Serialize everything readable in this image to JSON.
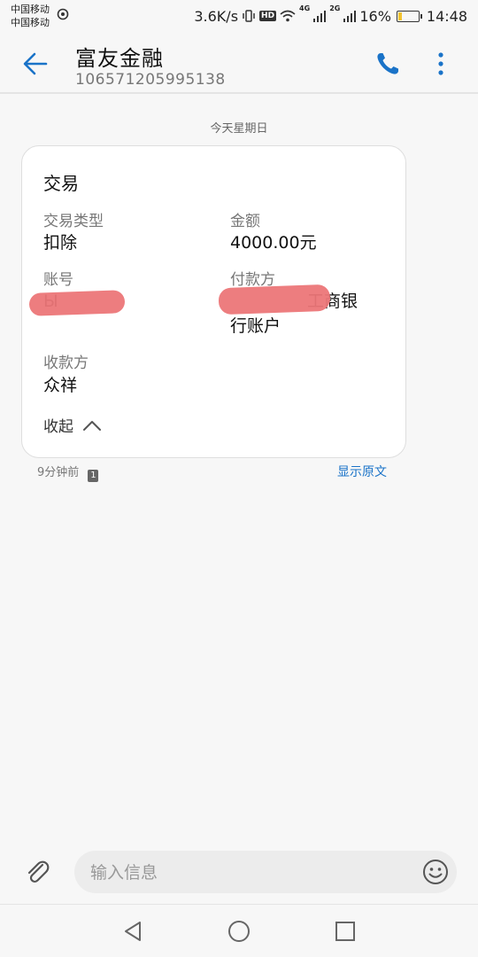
{
  "status_bar": {
    "carrier1": "中国移动",
    "carrier2": "中国移动",
    "speed": "3.6K/s",
    "hd": "HD",
    "net1": "4G",
    "net2": "2G",
    "battery": "16%",
    "battery_level": 0.16,
    "time": "14:48"
  },
  "header": {
    "title": "富友金融",
    "number": "106571205995138"
  },
  "conversation": {
    "date_label": "今天星期日"
  },
  "card": {
    "title": "交易",
    "fields": [
      {
        "label": "交易类型",
        "value": "扣除"
      },
      {
        "label": "金额",
        "value": "4000.00元"
      },
      {
        "label": "账号",
        "value": "Ы"
      },
      {
        "label": "付款方",
        "value_line1": "工商银",
        "value_line2": "行账户"
      },
      {
        "label": "收款方",
        "value": "众祥"
      }
    ],
    "collapse_label": "收起"
  },
  "message_meta": {
    "time_ago": "9分钟前",
    "sim": "1",
    "show_original": "显示原文"
  },
  "composer": {
    "placeholder": "输入信息"
  },
  "colors": {
    "accent": "#1a73c8",
    "redaction": "#ec7678",
    "battery": "#f2c230"
  }
}
